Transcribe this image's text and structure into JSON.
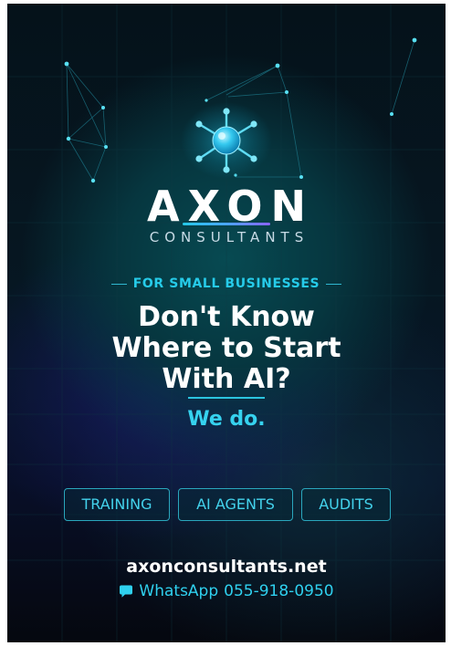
{
  "brand": {
    "name": "AXON",
    "subtitle": "CONSULTANTS"
  },
  "hero": {
    "kicker": "FOR SMALL BUSINESSES",
    "headline_lines": [
      "Don't Know",
      "Where to Start",
      "With AI?"
    ],
    "tagline": "We do."
  },
  "services": [
    {
      "label": "TRAINING"
    },
    {
      "label": "AI AGENTS"
    },
    {
      "label": "AUDITS"
    }
  ],
  "contact": {
    "website": "axonconsultants.net",
    "whatsapp_label": "WhatsApp",
    "phone": "055-918-0950"
  },
  "colors": {
    "accent": "#26cbe9",
    "background": "#061722",
    "text": "#ffffff"
  },
  "icons": {
    "logo": "neural-hub-icon",
    "whatsapp": "chat-bubble-icon"
  }
}
